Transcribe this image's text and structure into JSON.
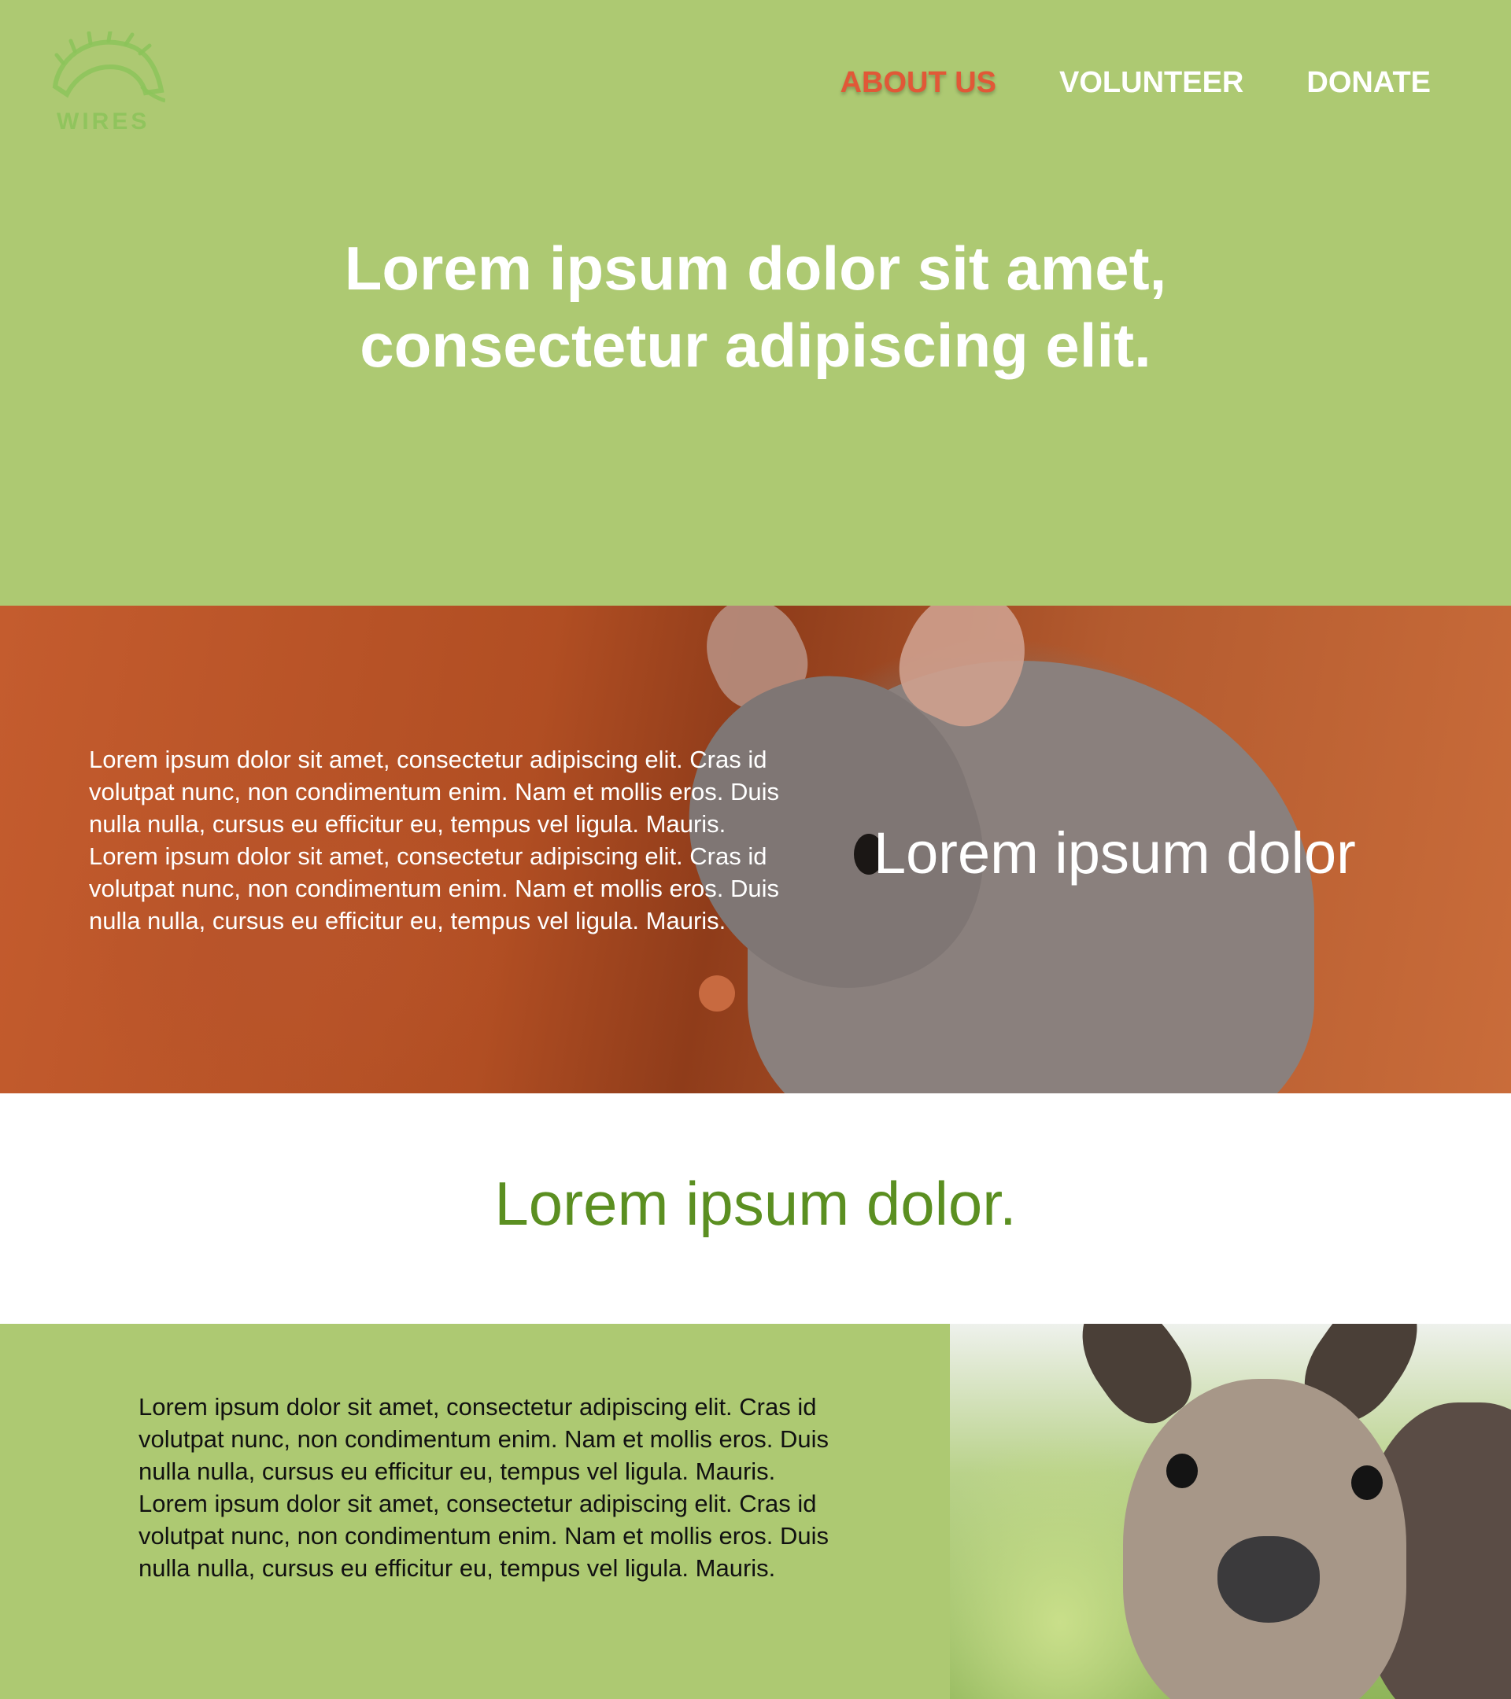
{
  "brand": {
    "logo_text": "WIRES",
    "logo_icon": "echidna-logo-icon"
  },
  "nav": {
    "items": [
      {
        "label": "ABOUT US",
        "active": true
      },
      {
        "label": "VOLUNTEER",
        "active": false
      },
      {
        "label": "DONATE",
        "active": false
      }
    ]
  },
  "hero": {
    "title_line1": "Lorem ipsum dolor sit amet,",
    "title_line2": "consectetur adipiscing elit."
  },
  "feature": {
    "body": "Lorem ipsum dolor sit amet, consectetur adipiscing elit. Cras id volutpat nunc, non condimentum enim. Nam et mollis eros. Duis nulla nulla, cursus eu efficitur eu, tempus vel ligula. Mauris. Lorem ipsum dolor sit amet, consectetur adipiscing elit. Cras id volutpat nunc, non condimentum enim. Nam et mollis eros. Duis nulla nulla, cursus eu efficitur eu, tempus vel ligula. Mauris.",
    "title": "Lorem ipsum dolor"
  },
  "section": {
    "title": "Lorem ipsum dolor."
  },
  "info": {
    "body": "Lorem ipsum dolor sit amet, consectetur adipiscing elit. Cras id volutpat nunc, non condimentum enim. Nam et mollis eros. Duis nulla nulla, cursus eu efficitur eu, tempus vel ligula. Mauris. Lorem ipsum dolor sit amet, consectetur adipiscing elit. Cras id volutpat nunc, non condimentum enim. Nam et mollis eros. Duis nulla nulla, cursus eu efficitur eu, tempus vel ligula. Mauris."
  },
  "colors": {
    "hero_bg": "#adc972",
    "nav_active": "#e15837",
    "section_title": "#5b8f21"
  }
}
